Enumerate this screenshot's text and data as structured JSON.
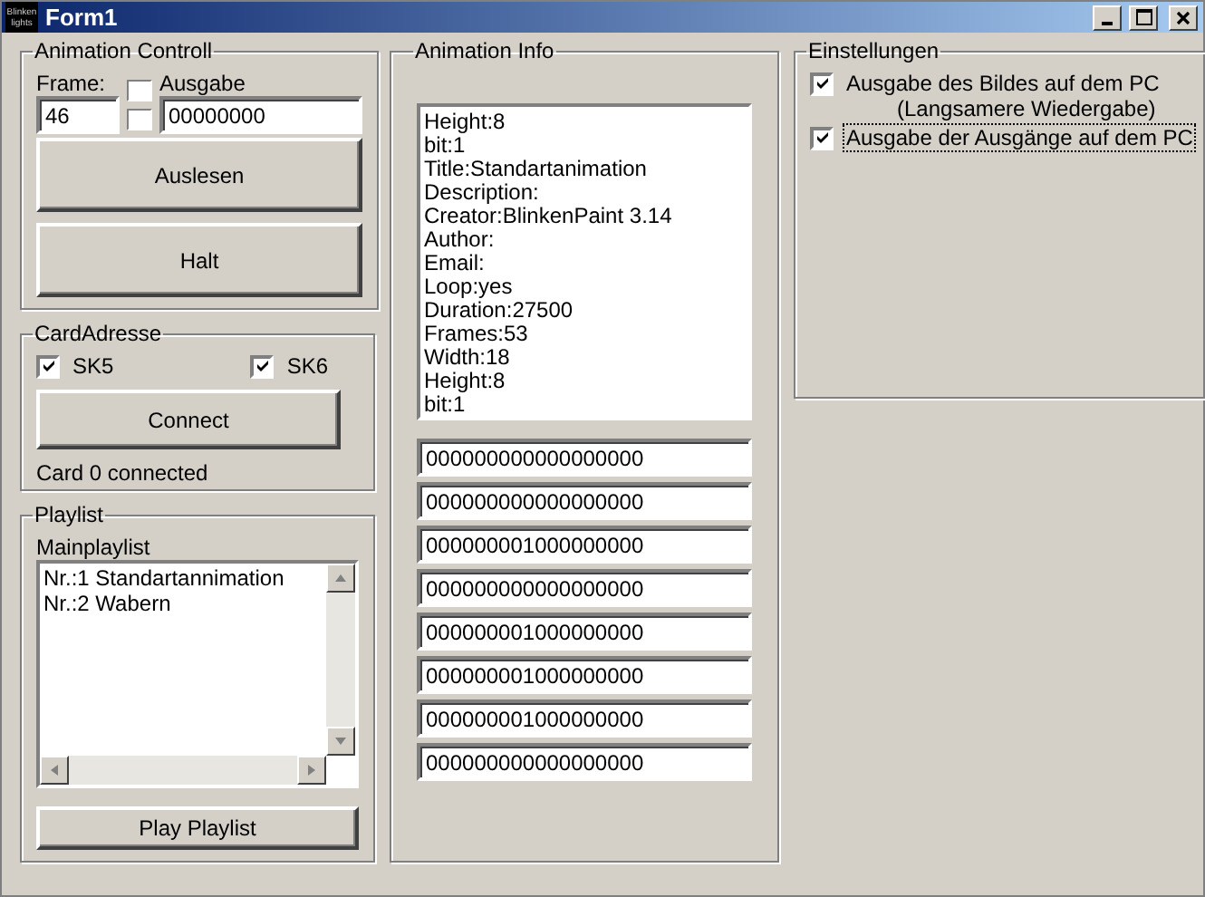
{
  "window": {
    "title": "Form1",
    "icon_text": [
      "Blinken",
      "lights"
    ]
  },
  "animation_control": {
    "title": "Animation Controll",
    "frame_label": "Frame:",
    "frame_value": "46",
    "output_label": "Ausgabe",
    "output_value": "00000000",
    "buttons": [
      "Auslesen",
      "Halt"
    ]
  },
  "card_address": {
    "title": "CardAdresse",
    "checkboxes": [
      {
        "label": "SK5",
        "checked": true
      },
      {
        "label": "SK6",
        "checked": true
      }
    ],
    "button": "Connect",
    "status": "Card 0 connected"
  },
  "playlist": {
    "title": "Playlist",
    "label": "Mainplaylist",
    "items": [
      "Nr.:1 Standartannimation",
      "Nr.:2 Wabern"
    ],
    "button": "Play Playlist"
  },
  "animation_info": {
    "title": "Animation Info",
    "memo_lines": [
      "Height:8",
      "bit:1",
      "Title:Standartanimation",
      "Description:",
      "Creator:BlinkenPaint 3.14",
      "Author:",
      "Email:",
      "Loop:yes",
      "Duration:27500",
      "Frames:53",
      "Width:18",
      "Height:8",
      "bit:1"
    ],
    "rows": [
      "000000000000000000",
      "000000000000000000",
      "000000001000000000",
      "000000000000000000",
      "000000001000000000",
      "000000001000000000",
      "000000001000000000",
      "000000000000000000"
    ]
  },
  "settings": {
    "title": "Einstellungen",
    "options": [
      {
        "label": "Ausgabe des Bildes auf dem PC",
        "note": "(Langsamere Wiedergabe)",
        "checked": true,
        "focused": false
      },
      {
        "label": "Ausgabe der Ausgänge auf dem PC",
        "checked": true,
        "focused": true
      }
    ]
  }
}
